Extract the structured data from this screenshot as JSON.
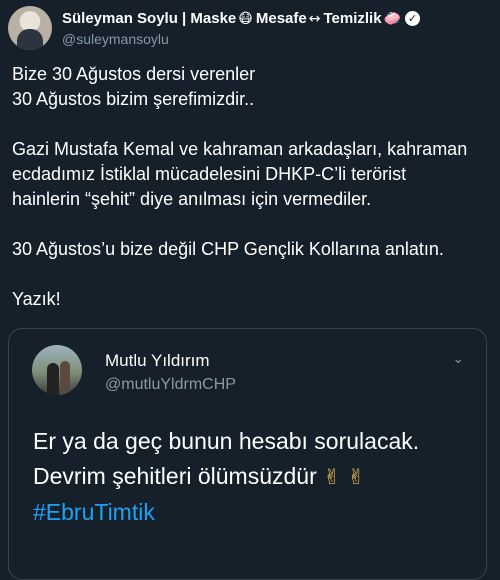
{
  "tweet": {
    "author": {
      "name": "Süleyman Soylu | Maske",
      "name_part2": "Mesafe",
      "name_part3": "Temizlik",
      "emoji_mask": "😷",
      "emoji_distance": "↔",
      "emoji_clean": "🧼",
      "verified_mark": "✓",
      "handle": "@suleymansoylu"
    },
    "paragraphs": [
      "Bize 30 Ağustos dersi verenler",
      "30 Ağustos bizim şerefimizdir..",
      "Gazi Mustafa Kemal ve kahraman arkadaşları, kahraman",
      "ecdadımız İstiklal mücadelesini DHKP-C’li terörist",
      "hainlerin “şehit” diye anılması için vermediler.",
      "30 Ağustos’u bize değil CHP Gençlik Kollarına anlatın.",
      "Yazık!"
    ]
  },
  "quoted": {
    "name": "Mutlu Yıldırım",
    "handle": "@mutluYldrmCHP",
    "chevron": "⌄",
    "line1": "Er ya da geç bunun hesabı sorulacak.",
    "line2": "Devrim şehitleri ölümsüzdür",
    "victory": "✌ ✌",
    "hashtag": "#EbruTimtik"
  },
  "colors": {
    "background": "#15202b",
    "secondary_text": "#8899a6",
    "link": "#1da1f2",
    "border": "#38444d"
  }
}
